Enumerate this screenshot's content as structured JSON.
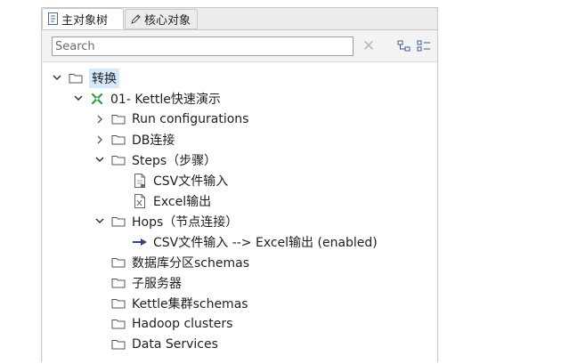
{
  "tabs": [
    {
      "label": "主对象树",
      "active": true,
      "icon": "tree-document-icon"
    },
    {
      "label": "核心对象",
      "active": false,
      "icon": "pencil-icon"
    }
  ],
  "search": {
    "placeholder": "Search",
    "value": ""
  },
  "toolbar": {
    "clear_icon": "close-icon",
    "buttons": [
      "expand-all-icon",
      "collapse-all-icon"
    ]
  },
  "tree": [
    {
      "label": "转换",
      "level": 0,
      "expanded": true,
      "icon": "folder-icon",
      "selected": true
    },
    {
      "label": "01- Kettle快速演示",
      "level": 1,
      "expanded": true,
      "icon": "transformation-icon"
    },
    {
      "label": "Run configurations",
      "level": 2,
      "expanded": false,
      "icon": "folder-icon"
    },
    {
      "label": "DB连接",
      "level": 2,
      "expanded": false,
      "icon": "folder-icon"
    },
    {
      "label": "Steps（步骤）",
      "level": 2,
      "expanded": true,
      "icon": "folder-icon"
    },
    {
      "label": "CSV文件输入",
      "level": 3,
      "icon": "csv-file-icon"
    },
    {
      "label": "Excel输出",
      "level": 3,
      "icon": "excel-file-icon"
    },
    {
      "label": "Hops（节点连接）",
      "level": 2,
      "expanded": true,
      "icon": "folder-icon"
    },
    {
      "label": "CSV文件输入 --> Excel输出 (enabled)",
      "level": 3,
      "icon": "hop-arrow-icon"
    },
    {
      "label": "数据库分区schemas",
      "level": 2,
      "icon": "folder-icon"
    },
    {
      "label": "子服务器",
      "level": 2,
      "icon": "folder-icon"
    },
    {
      "label": "Kettle集群schemas",
      "level": 2,
      "icon": "folder-icon"
    },
    {
      "label": "Hadoop clusters",
      "level": 2,
      "icon": "folder-icon"
    },
    {
      "label": "Data Services",
      "level": 2,
      "icon": "folder-icon"
    }
  ],
  "colors": {
    "selection": "#d6e8fb",
    "accent_green": "#2e9a3a",
    "hop_blue": "#2a4a8a"
  }
}
